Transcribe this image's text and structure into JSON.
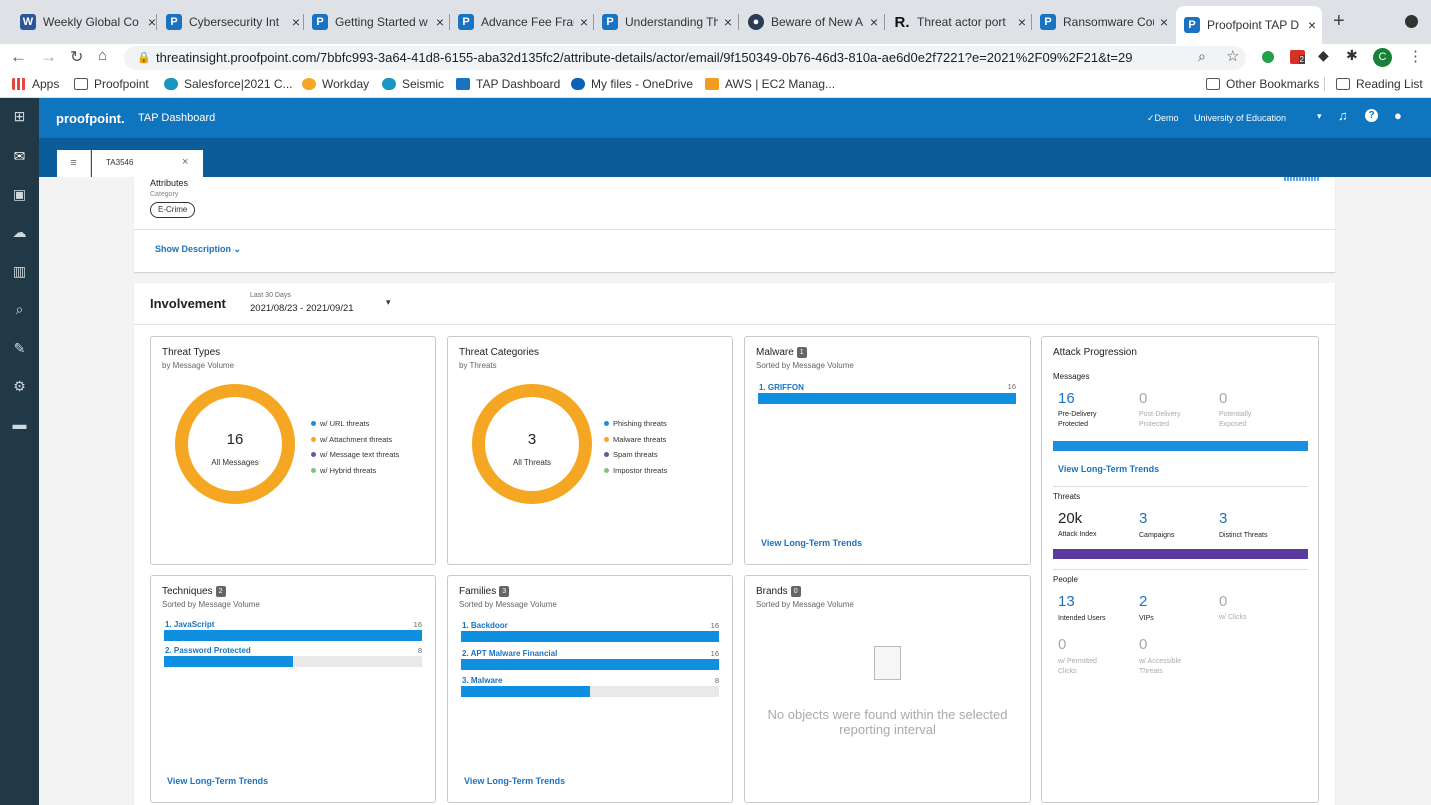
{
  "browser": {
    "tabs": [
      {
        "title": "Weekly Global Co",
        "icon": "word-icon",
        "color": "#2b579a",
        "glyph": "W"
      },
      {
        "title": "Cybersecurity Int",
        "icon": "proofpoint-icon",
        "color": "#1a73c1",
        "glyph": "P"
      },
      {
        "title": "Getting Started w",
        "icon": "proofpoint-icon",
        "color": "#1a73c1",
        "glyph": "P"
      },
      {
        "title": "Advance Fee Frau",
        "icon": "proofpoint-icon",
        "color": "#1a73c1",
        "glyph": "P"
      },
      {
        "title": "Understanding Th",
        "icon": "proofpoint-icon",
        "color": "#1a73c1",
        "glyph": "P"
      },
      {
        "title": "Beware of New A",
        "icon": "globe-icon",
        "color": "#2b3a55",
        "glyph": "●"
      },
      {
        "title": "Threat actor port",
        "icon": "r-icon",
        "color": "#222",
        "glyph": "R"
      },
      {
        "title": "Ransomware Cou",
        "icon": "proofpoint-icon",
        "color": "#1a73c1",
        "glyph": "P"
      },
      {
        "title": "Proofpoint TAP D",
        "icon": "proofpoint-icon",
        "color": "#1a73c1",
        "glyph": "P"
      }
    ],
    "url": "threatinsight.proofpoint.com/7bbfc993-3a64-41d8-6155-aba32d135fc2/attribute-details/actor/email/9f150349-0b76-46d3-810a-ae6d0e2f7221?e=2021%2F09%2F21&t=29",
    "bookmarks": [
      "Apps",
      "Proofpoint",
      "Salesforce|2021 C...",
      "Workday",
      "Seismic",
      "TAP Dashboard",
      "My files - OneDrive",
      "AWS | EC2 Manag..."
    ],
    "other_bookmarks": "Other Bookmarks",
    "reading_list": "Reading List",
    "profile_initial": "C",
    "ext_badge": "2"
  },
  "app": {
    "logo": "proofpoint.",
    "title": "TAP Dashboard",
    "demo": "✓Demo",
    "org": "University of Education",
    "tab_label": "TA3546"
  },
  "attributes": {
    "heading": "Attributes",
    "category_label": "Category",
    "category_value": "E-Crime",
    "show_description": "Show Description"
  },
  "involvement": {
    "title": "Involvement",
    "range_label": "Last 30 Days",
    "range_value": "2021/08/23 - 2021/09/21"
  },
  "threat_types": {
    "title": "Threat Types",
    "subtitle": "by Message Volume",
    "total": "16",
    "total_label": "All Messages",
    "legend": [
      {
        "label": "w/ URL threats",
        "color": "#1a8fe0"
      },
      {
        "label": "w/ Attachment threats",
        "color": "#f5a623"
      },
      {
        "label": "w/ Message text threats",
        "color": "#5b5ea6"
      },
      {
        "label": "w/ Hybrid threats",
        "color": "#7cc576"
      }
    ]
  },
  "threat_categories": {
    "title": "Threat Categories",
    "subtitle": "by Threats",
    "total": "3",
    "total_label": "All Threats",
    "legend": [
      {
        "label": "Phishing threats",
        "color": "#1a8fe0"
      },
      {
        "label": "Malware threats",
        "color": "#f5a623"
      },
      {
        "label": "Spam threats",
        "color": "#5b5ea6"
      },
      {
        "label": "Impostor threats",
        "color": "#7cc576"
      }
    ]
  },
  "malware": {
    "title": "Malware",
    "count": "1",
    "subtitle": "Sorted by Message Volume",
    "items": [
      {
        "label": "1. GRIFFON",
        "value": 16,
        "fraction": 1.0
      }
    ],
    "link": "View Long-Term Trends"
  },
  "techniques": {
    "title": "Techniques",
    "count": "2",
    "subtitle": "Sorted by Message Volume",
    "items": [
      {
        "label": "1. JavaScript",
        "value": 16,
        "fraction": 1.0
      },
      {
        "label": "2. Password Protected",
        "value": 8,
        "fraction": 0.5
      }
    ],
    "link": "View Long-Term Trends"
  },
  "families": {
    "title": "Families",
    "count": "3",
    "subtitle": "Sorted by Message Volume",
    "items": [
      {
        "label": "1. Backdoor",
        "value": 16,
        "fraction": 1.0
      },
      {
        "label": "2. APT Malware Financial",
        "value": 16,
        "fraction": 1.0
      },
      {
        "label": "3. Malware",
        "value": 8,
        "fraction": 0.5
      }
    ],
    "link": "View Long-Term Trends"
  },
  "brands": {
    "title": "Brands",
    "count": "0",
    "subtitle": "Sorted by Message Volume",
    "empty": "No objects were found within the selected reporting interval"
  },
  "attack": {
    "title": "Attack Progression",
    "messages_label": "Messages",
    "messages": [
      {
        "value": "16",
        "label": "Pre-Delivery Protected"
      },
      {
        "value": "0",
        "label": "Post-Delivery Protected"
      },
      {
        "value": "0",
        "label": "Potentially Exposed"
      }
    ],
    "link": "View Long-Term Trends",
    "threats_label": "Threats",
    "threats": [
      {
        "value": "20k",
        "label": "Attack Index"
      },
      {
        "value": "3",
        "label": "Campaigns"
      },
      {
        "value": "3",
        "label": "Distinct Threats"
      }
    ],
    "people_label": "People",
    "people": [
      {
        "value": "13",
        "label": "Intended Users"
      },
      {
        "value": "2",
        "label": "VIPs"
      },
      {
        "value": "0",
        "label": "w/ Clicks"
      },
      {
        "value": "0",
        "label": "w/ Permitted Clicks"
      },
      {
        "value": "0",
        "label": "w/ Accessible Threats"
      }
    ],
    "colors": {
      "messages_bar": "#1a8fe0",
      "threats_bar": "#5b3aa0"
    }
  }
}
